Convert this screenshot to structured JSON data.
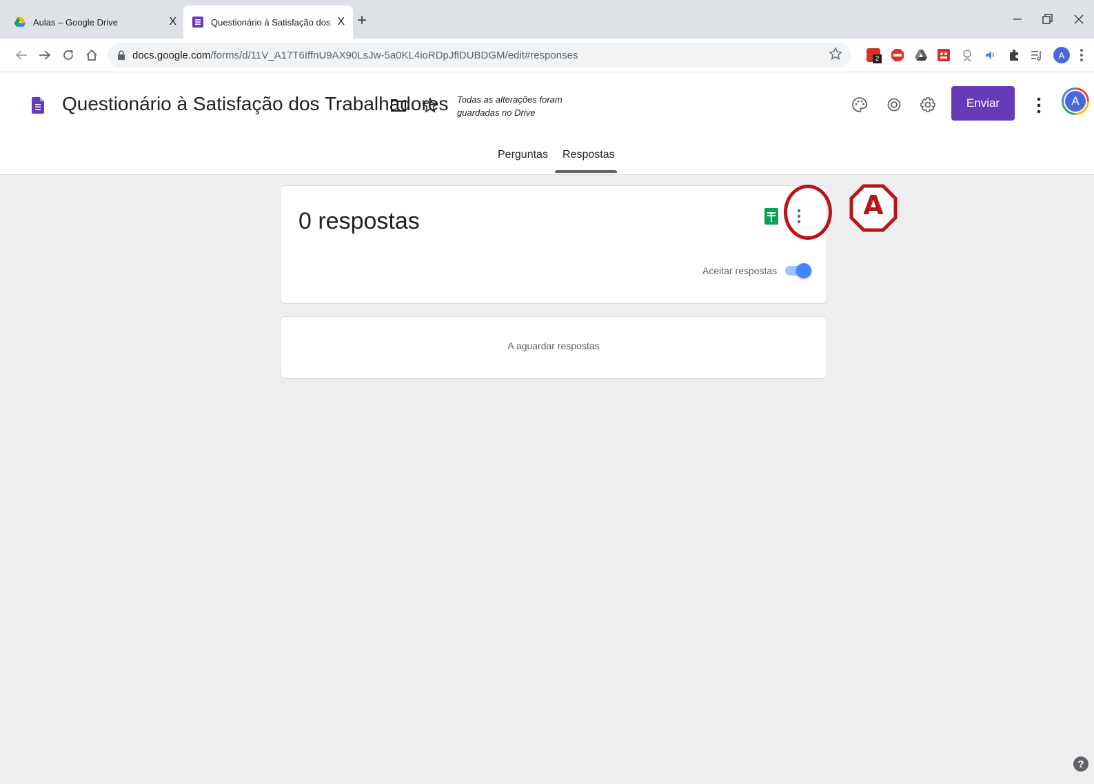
{
  "browser": {
    "tabs": [
      {
        "label": "Aulas – Google Drive",
        "icon": "google-drive-icon",
        "active": false
      },
      {
        "label": "Questionário à Satisfação dos Tra",
        "icon": "google-forms-icon",
        "active": true
      }
    ],
    "close_glyph": "X",
    "new_tab_glyph": "+",
    "url_host": "docs.google.com",
    "url_path": "/forms/d/11V_A17T6IffnU9AX90LsJw-5a0KL4ioRDpJflDUBDGM/edit#responses",
    "profile_initial": "A",
    "extension_badge": "2"
  },
  "form_header": {
    "title": "Questionário à Satisfação dos Trabalhadores",
    "saved_status": "Todas as alterações foram guardadas no Drive",
    "send_label": "Enviar",
    "avatar_initial": "A",
    "accent_color": "#673ab7"
  },
  "tabs": {
    "questions": "Perguntas",
    "responses": "Respostas",
    "active": "Respostas"
  },
  "responses_card": {
    "count_label": "0 respostas",
    "accept_label": "Aceitar respostas",
    "accepting": true
  },
  "waiting_card": {
    "text": "A aguardar respostas"
  },
  "annotation": {
    "letter": "A",
    "color": "#b8141a"
  },
  "help": {
    "glyph": "?"
  }
}
